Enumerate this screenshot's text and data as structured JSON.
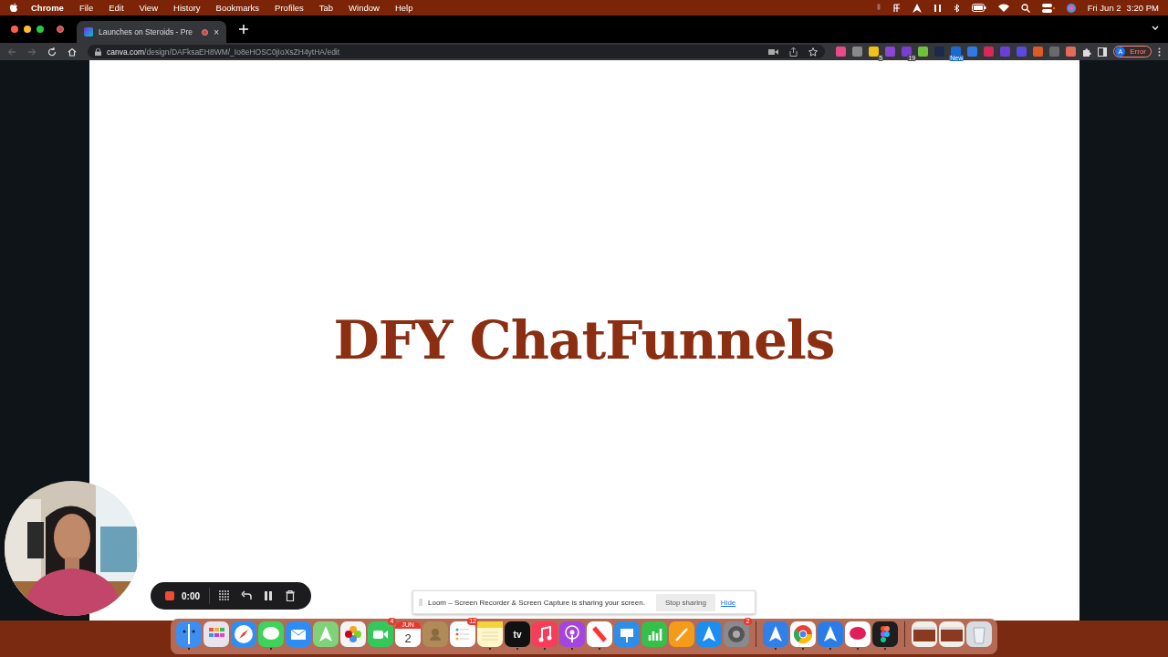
{
  "menu_bar": {
    "app": "Chrome",
    "items": [
      "File",
      "Edit",
      "View",
      "History",
      "Bookmarks",
      "Profiles",
      "Tab",
      "Window",
      "Help"
    ],
    "date": "Fri Jun 2",
    "time": "3:20 PM"
  },
  "browser": {
    "tabs": [
      {
        "title": "Launches on Steroids - Pre",
        "selected": true,
        "close": "×"
      }
    ],
    "url": {
      "host": "canva.com",
      "path": "/design/DAFksaEH8WM/_Io8eHOSC0jIoXsZH4ytHA/edit"
    },
    "extensions": [
      {
        "color": "#e84b8a"
      },
      {
        "color": "#8a8a8a"
      },
      {
        "color": "#f2c118",
        "badge": "5"
      },
      {
        "color": "#8e44d6"
      },
      {
        "color": "#7b3fd0",
        "badge": "19"
      },
      {
        "color": "#6fc23a"
      },
      {
        "color": "#1b2a4a"
      },
      {
        "color": "#1b6ad0",
        "badge": "New"
      },
      {
        "color": "#2e7be6"
      },
      {
        "color": "#d8285a"
      },
      {
        "color": "#6a3fd6"
      },
      {
        "color": "#5a4ae0"
      },
      {
        "color": "#e0592a"
      },
      {
        "color": "#6a6a6a"
      },
      {
        "color": "#e46a5a"
      }
    ],
    "profile": {
      "initial": "A",
      "status": "Error"
    }
  },
  "slide": {
    "title": "DFY ChatFunnels"
  },
  "recorder": {
    "time": "0:00"
  },
  "share_bar": {
    "message": "Loom – Screen Recorder & Screen Capture is sharing your screen.",
    "stop": "Stop sharing",
    "hide": "Hide"
  },
  "dock": {
    "apps": [
      {
        "kind": "finder",
        "running": true
      },
      {
        "kind": "grid",
        "running": false
      },
      {
        "kind": "compass",
        "running": false
      },
      {
        "kind": "chat",
        "running": true
      },
      {
        "kind": "mail",
        "running": false
      },
      {
        "kind": "map",
        "running": false
      },
      {
        "kind": "flower",
        "running": false
      },
      {
        "kind": "video",
        "running": false,
        "badge": "4"
      },
      {
        "kind": "calendar",
        "running": false,
        "month": "JUN",
        "day": "2"
      },
      {
        "kind": "contacts",
        "running": false
      },
      {
        "kind": "list",
        "running": false,
        "badge": "12"
      },
      {
        "kind": "notes",
        "running": true
      },
      {
        "kind": "tv",
        "running": true,
        "label": "tv"
      },
      {
        "kind": "music",
        "running": true
      },
      {
        "kind": "podcast",
        "running": true
      },
      {
        "kind": "news",
        "running": true
      },
      {
        "kind": "keynote",
        "running": false
      },
      {
        "kind": "chart",
        "running": false
      },
      {
        "kind": "pen",
        "running": false
      },
      {
        "kind": "store",
        "running": false
      },
      {
        "kind": "gear",
        "running": false,
        "badge": "2"
      },
      {
        "kind": "separator"
      },
      {
        "kind": "nav",
        "running": true
      },
      {
        "kind": "browser",
        "running": true
      },
      {
        "kind": "plane",
        "running": true
      },
      {
        "kind": "hash",
        "running": true
      },
      {
        "kind": "figma",
        "running": true
      },
      {
        "kind": "separator"
      },
      {
        "kind": "window",
        "running": false
      },
      {
        "kind": "window",
        "running": false
      },
      {
        "kind": "trash",
        "running": false
      }
    ]
  }
}
